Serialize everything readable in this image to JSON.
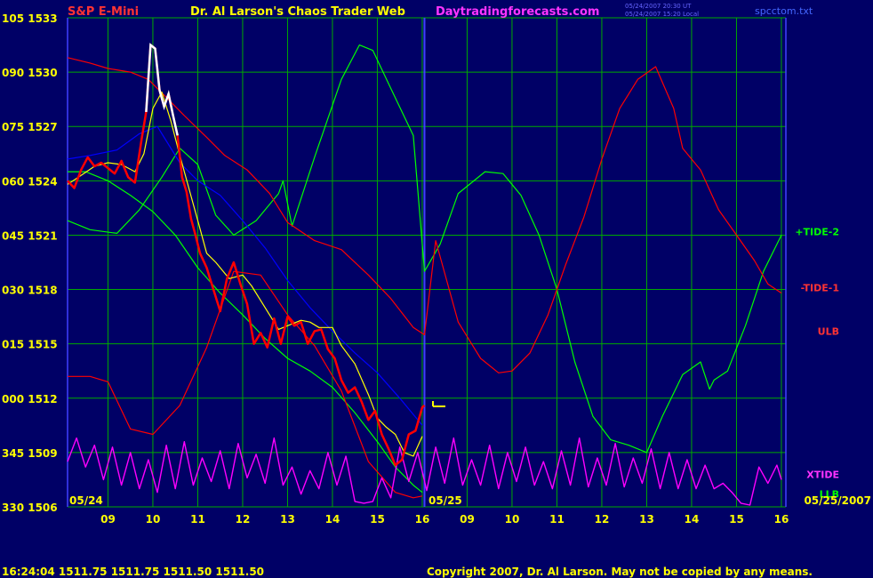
{
  "header": {
    "instrument": "S&P E-Mini",
    "title": "Dr. Al Larson's Chaos Trader Web",
    "site": "Daytradingforecasts.com",
    "timestamp_line1": "05/24/2007 20:30 UT",
    "timestamp_line2": "05/24/2007 15:20 Local",
    "filename": "spcctom.txt"
  },
  "footer": {
    "quote_line": "16:24:04  1511.75 1511.75 1511.50 1511.50",
    "copyright": "Copyright 2007, Dr. Al Larson. May not be copied by any means."
  },
  "colors": {
    "background": "#000066",
    "grid": "#00aa00",
    "axis": "#4040ff",
    "price_bars": "#ff0000",
    "price_recent": "#ffffff",
    "moving_average": "#ffff00",
    "tide2": "#00ff00",
    "tide1": "#ff0000",
    "channel": "#0000ff",
    "xtide": "#ff00ff",
    "text_yellow": "#ffff00",
    "text_red": "#ff3333",
    "text_magenta": "#ff33ff"
  },
  "chart_data": {
    "type": "line",
    "ylim": [
      1506,
      1533
    ],
    "y_ticks": [
      {
        "label": "105 1533",
        "value": 1533
      },
      {
        "label": "090 1530",
        "value": 1530
      },
      {
        "label": "075 1527",
        "value": 1527
      },
      {
        "label": "060 1524",
        "value": 1524
      },
      {
        "label": "045 1521",
        "value": 1521
      },
      {
        "label": "030 1518",
        "value": 1518
      },
      {
        "label": "015 1515",
        "value": 1515
      },
      {
        "label": "000 1512",
        "value": 1512
      },
      {
        "label": "345 1509",
        "value": 1509
      },
      {
        "label": "330 1506",
        "value": 1506
      }
    ],
    "x_ticks": [
      {
        "label": "09",
        "value": 9
      },
      {
        "label": "10",
        "value": 10
      },
      {
        "label": "11",
        "value": 11
      },
      {
        "label": "12",
        "value": 12
      },
      {
        "label": "13",
        "value": 13
      },
      {
        "label": "14",
        "value": 14
      },
      {
        "label": "15",
        "value": 15
      },
      {
        "label": "16",
        "value": 16
      },
      {
        "label": "09",
        "value": 17
      },
      {
        "label": "10",
        "value": 18
      },
      {
        "label": "11",
        "value": 19
      },
      {
        "label": "12",
        "value": 20
      },
      {
        "label": "13",
        "value": 21
      },
      {
        "label": "14",
        "value": 22
      },
      {
        "label": "15",
        "value": 23
      },
      {
        "label": "16",
        "value": 24
      }
    ],
    "xlim": [
      8.1,
      24.1
    ],
    "day_separator_x": 16.05,
    "date_labels": [
      {
        "label": "05/24",
        "x": 8.1
      },
      {
        "label": "05/25",
        "x": 16.1
      },
      {
        "label": "05/25/2007",
        "x": 24.1
      }
    ],
    "right_labels": [
      {
        "label": "+TIDE-2",
        "value": 1521.2
      },
      {
        "label": "-TIDE-1",
        "value": 1518.1
      },
      {
        "label": "ULB",
        "value": 1515.7
      },
      {
        "label": "XTIDE",
        "value": 1507.8
      },
      {
        "label": "LLB",
        "value": 1506.7
      }
    ],
    "series": [
      {
        "name": "+TIDE-2",
        "x": [
          8.1,
          8.6,
          9.2,
          9.7,
          10.2,
          10.6,
          11.0,
          11.4,
          11.8,
          12.3,
          12.8,
          12.9,
          13.1,
          13.6,
          14.2,
          14.6,
          14.9,
          15.3,
          15.8,
          16.05,
          16.4,
          16.8,
          17.4,
          17.8,
          18.2,
          18.6,
          19.0,
          19.4,
          19.8,
          20.2,
          20.6,
          21.0,
          21.35,
          21.8,
          22.2,
          22.4,
          22.5,
          22.8,
          23.2,
          23.6,
          24.0
        ],
        "values": [
          1521.8,
          1521.3,
          1521.1,
          1522.4,
          1524.2,
          1525.8,
          1524.9,
          1522.1,
          1521.0,
          1521.8,
          1523.3,
          1524.0,
          1521.5,
          1525.3,
          1529.6,
          1531.5,
          1531.2,
          1529.1,
          1526.5,
          1519.0,
          1520.5,
          1523.3,
          1524.5,
          1524.4,
          1523.2,
          1521.0,
          1518.0,
          1514.0,
          1511.0,
          1509.7,
          1509.4,
          1509.0,
          1511.0,
          1513.3,
          1514.0,
          1512.5,
          1513.0,
          1513.5,
          1516.0,
          1519.0,
          1521.0
        ]
      },
      {
        "name": "-TIDE-1",
        "x": [
          8.1,
          8.6,
          9.0,
          9.5,
          9.9,
          10.3,
          10.7,
          11.2,
          11.6,
          12.1,
          12.6,
          13.0,
          13.6,
          14.2,
          14.8,
          15.3,
          15.8,
          16.05,
          16.3,
          16.8,
          17.3,
          17.7,
          18.0,
          18.4,
          18.8,
          19.2,
          19.6,
          20.0,
          20.4,
          20.8,
          21.2,
          21.6,
          21.8,
          22.2,
          22.6,
          23.0,
          23.4,
          23.7,
          24.0
        ],
        "values": [
          1530.8,
          1530.5,
          1530.2,
          1530.0,
          1529.6,
          1528.6,
          1527.6,
          1526.4,
          1525.4,
          1524.6,
          1523.3,
          1521.7,
          1520.7,
          1520.2,
          1518.8,
          1517.5,
          1515.9,
          1515.5,
          1520.7,
          1516.2,
          1514.2,
          1513.4,
          1513.5,
          1514.5,
          1516.6,
          1519.4,
          1522.0,
          1525.2,
          1528.0,
          1529.6,
          1530.3,
          1528.0,
          1525.8,
          1524.6,
          1522.4,
          1521.0,
          1519.6,
          1518.3,
          1517.8
        ]
      },
      {
        "name": "Channel",
        "x": [
          8.1,
          8.6,
          9.2,
          9.7,
          10.1,
          10.6,
          11.0,
          11.5,
          12.0,
          12.5,
          13.0,
          13.5,
          14.0,
          14.5,
          15.0,
          15.5,
          16.0
        ],
        "values": [
          1525.2,
          1525.4,
          1525.7,
          1526.6,
          1527.0,
          1525.0,
          1524.0,
          1523.2,
          1521.8,
          1520.3,
          1518.5,
          1517.0,
          1515.7,
          1514.5,
          1513.4,
          1512.0,
          1510.5
        ]
      },
      {
        "name": "LLB",
        "x": [
          8.1,
          8.5,
          9.0,
          9.5,
          10.0,
          10.5,
          11.0,
          11.5,
          12.0,
          12.5,
          13.0,
          13.5,
          14.0,
          14.5,
          15.0,
          15.4,
          15.8,
          16.0
        ],
        "values": [
          1524.5,
          1524.5,
          1524.0,
          1523.2,
          1522.3,
          1521.0,
          1519.2,
          1517.8,
          1516.6,
          1515.3,
          1514.2,
          1513.5,
          1512.6,
          1511.2,
          1509.6,
          1508.2,
          1507.2,
          1506.8
        ]
      },
      {
        "name": "Lower red band",
        "x": [
          8.1,
          8.6,
          9.0,
          9.5,
          10.0,
          10.6,
          11.2,
          11.8,
          12.4,
          13.0,
          13.6,
          14.2,
          14.8,
          15.4,
          15.8,
          16.0
        ],
        "values": [
          1513.2,
          1513.2,
          1512.9,
          1510.3,
          1510.0,
          1511.6,
          1514.8,
          1519.0,
          1518.8,
          1516.6,
          1514.9,
          1512.4,
          1508.5,
          1506.8,
          1506.5,
          1506.6
        ]
      },
      {
        "name": "XTIDE",
        "x": [
          8.1,
          8.3,
          8.5,
          8.7,
          8.9,
          9.1,
          9.3,
          9.5,
          9.7,
          9.9,
          10.1,
          10.3,
          10.5,
          10.7,
          10.9,
          11.1,
          11.3,
          11.5,
          11.7,
          11.9,
          12.1,
          12.3,
          12.5,
          12.7,
          12.9,
          13.1,
          13.3,
          13.5,
          13.7,
          13.9,
          14.1,
          14.3,
          14.5,
          14.7,
          14.9,
          15.1,
          15.3,
          15.5,
          15.7,
          15.9,
          16.1,
          16.3,
          16.5,
          16.7,
          16.9,
          17.1,
          17.3,
          17.5,
          17.7,
          17.9,
          18.1,
          18.3,
          18.5,
          18.7,
          18.9,
          19.1,
          19.3,
          19.5,
          19.7,
          19.9,
          20.1,
          20.3,
          20.5,
          20.7,
          20.9,
          21.1,
          21.3,
          21.5,
          21.7,
          21.9,
          22.1,
          22.3,
          22.5,
          22.7,
          22.9,
          23.1,
          23.3,
          23.5,
          23.7,
          23.9,
          24.0
        ],
        "values": [
          1508.5,
          1509.8,
          1508.2,
          1509.4,
          1507.5,
          1509.3,
          1507.2,
          1509.0,
          1507.0,
          1508.6,
          1506.8,
          1509.4,
          1507.0,
          1509.6,
          1507.2,
          1508.7,
          1507.4,
          1509.1,
          1507.0,
          1509.5,
          1507.6,
          1508.9,
          1507.3,
          1509.8,
          1507.2,
          1508.2,
          1506.7,
          1508.0,
          1507.0,
          1509.0,
          1507.2,
          1508.8,
          1506.3,
          1506.2,
          1506.3,
          1507.6,
          1506.5,
          1509.3,
          1507.4,
          1509.0,
          1506.9,
          1509.3,
          1507.3,
          1509.8,
          1507.2,
          1508.6,
          1507.2,
          1509.4,
          1507.0,
          1509.0,
          1507.4,
          1509.3,
          1507.2,
          1508.5,
          1507.0,
          1509.1,
          1507.2,
          1509.8,
          1507.1,
          1508.7,
          1507.2,
          1509.5,
          1507.1,
          1508.7,
          1507.3,
          1509.2,
          1507.0,
          1509.0,
          1507.0,
          1508.6,
          1507.0,
          1508.3,
          1507.0,
          1507.3,
          1506.8,
          1506.2,
          1506.1,
          1508.2,
          1507.3,
          1508.3,
          1507.5
        ]
      },
      {
        "name": "Moving average",
        "x": [
          8.1,
          8.4,
          8.7,
          9.0,
          9.3,
          9.6,
          9.8,
          10.0,
          10.2,
          10.4,
          10.6,
          10.8,
          11.0,
          11.2,
          11.4,
          11.7,
          12.0,
          12.2,
          12.5,
          12.8,
          13.0,
          13.3,
          13.5,
          13.7,
          14.0,
          14.2,
          14.5,
          14.8,
          15.0,
          15.2,
          15.4,
          15.6,
          15.8,
          16.0
        ],
        "values": [
          1523.8,
          1524.3,
          1524.8,
          1525.0,
          1524.9,
          1524.5,
          1525.5,
          1528.0,
          1528.9,
          1527.3,
          1525.4,
          1523.6,
          1521.8,
          1520.0,
          1519.5,
          1518.6,
          1518.8,
          1518.2,
          1517.0,
          1515.8,
          1516.0,
          1516.3,
          1516.2,
          1515.9,
          1515.9,
          1514.9,
          1513.9,
          1512.2,
          1510.9,
          1510.4,
          1510.0,
          1509.0,
          1508.8,
          1509.9
        ]
      },
      {
        "name": "Price",
        "x": [
          8.1,
          8.25,
          8.4,
          8.55,
          8.7,
          8.85,
          9.0,
          9.15,
          9.3,
          9.45,
          9.6,
          9.75,
          9.85,
          9.95,
          10.05,
          10.15,
          10.25,
          10.35,
          10.45,
          10.55,
          10.65,
          10.75,
          10.85,
          10.95,
          11.05,
          11.2,
          11.35,
          11.5,
          11.65,
          11.8,
          11.95,
          12.1,
          12.25,
          12.4,
          12.55,
          12.7,
          12.85,
          13.0,
          13.15,
          13.3,
          13.45,
          13.6,
          13.75,
          13.9,
          14.05,
          14.2,
          14.35,
          14.5,
          14.65,
          14.8,
          14.95,
          15.1,
          15.25,
          15.4,
          15.55,
          15.7,
          15.85,
          16.0,
          16.05
        ],
        "values": [
          1524.0,
          1523.6,
          1524.6,
          1525.3,
          1524.8,
          1525.0,
          1524.7,
          1524.4,
          1525.1,
          1524.2,
          1523.9,
          1526.3,
          1527.8,
          1531.5,
          1531.3,
          1529.0,
          1528.1,
          1528.8,
          1527.6,
          1526.5,
          1524.2,
          1523.4,
          1521.9,
          1521.0,
          1520.0,
          1519.2,
          1518.0,
          1516.8,
          1518.6,
          1519.5,
          1518.3,
          1517.2,
          1515.0,
          1515.6,
          1514.8,
          1516.4,
          1515.0,
          1516.5,
          1516.0,
          1516.2,
          1515.0,
          1515.7,
          1515.8,
          1514.7,
          1514.2,
          1513.0,
          1512.3,
          1512.6,
          1511.8,
          1510.8,
          1511.3,
          1510.0,
          1509.2,
          1508.3,
          1508.6,
          1510.0,
          1510.2,
          1511.5,
          1511.6
        ]
      }
    ]
  }
}
